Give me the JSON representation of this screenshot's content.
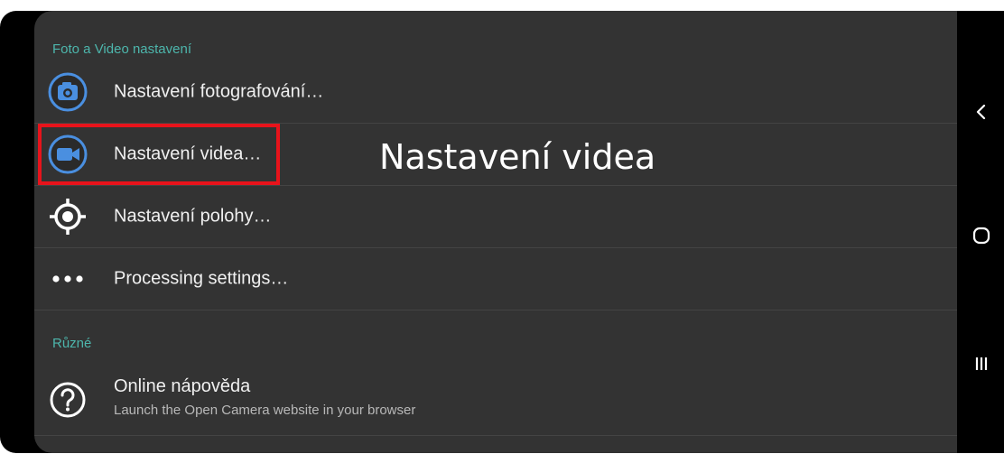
{
  "annotation": {
    "caption": "Nastavení videa"
  },
  "categories": {
    "photo_video": "Foto a Video nastavení",
    "misc": "Různé"
  },
  "settings": {
    "items": [
      {
        "label": "Nastavení fotografování…",
        "icon": "camera-icon"
      },
      {
        "label": "Nastavení videa…",
        "icon": "video-camera-icon"
      },
      {
        "label": "Nastavení polohy…",
        "icon": "location-target-icon"
      },
      {
        "label": "Processing settings…",
        "icon": "more-dots-icon"
      }
    ],
    "help": {
      "title": "Online nápověda",
      "summary": "Launch the Open Camera website in your browser",
      "icon": "help-icon"
    }
  },
  "navbar": {
    "buttons": [
      "back-icon",
      "home-icon",
      "recents-icon"
    ]
  },
  "colors": {
    "background": "#333333",
    "category": "#4db6ac",
    "icon_accent": "#4a8fe0",
    "highlight": "#e8131b",
    "text": "#f0f0f0"
  }
}
